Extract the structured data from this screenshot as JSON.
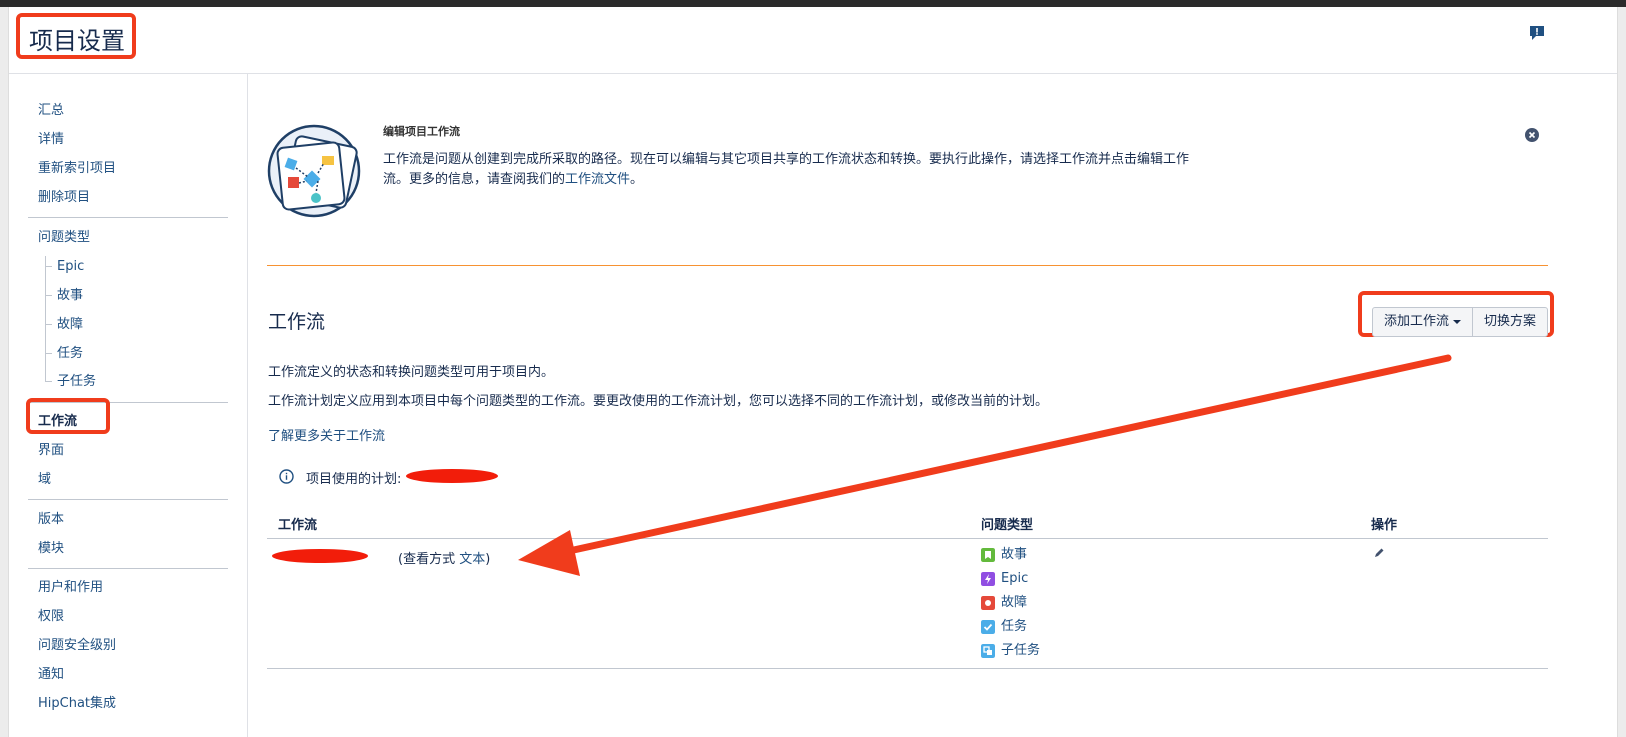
{
  "page": {
    "title": "项目设置"
  },
  "colors": {
    "annotation": "#f03c1c",
    "link": "#205081",
    "text": "#172b4d",
    "rule": "#f79232"
  },
  "sidebar": {
    "group1": [
      "汇总",
      "详情",
      "重新索引项目",
      "删除项目"
    ],
    "issue_types_label": "问题类型",
    "issue_types_sub": [
      "Epic",
      "故事",
      "故障",
      "任务",
      "子任务"
    ],
    "active": "工作流",
    "group2b": [
      "界面",
      "域"
    ],
    "group3": [
      "版本",
      "模块"
    ],
    "group4": [
      "用户和作用",
      "权限",
      "问题安全级别",
      "通知",
      "HipChat集成"
    ]
  },
  "info": {
    "title": "编辑项目工作流",
    "desc_part1": "工作流是问题从创建到完成所采取的路径。现在可以编辑与其它项目共享的工作流状态和转换。要执行此操作，请选择工作流并点击编辑工作流。更多的信息，请查阅我们的",
    "desc_link": "工作流文件",
    "desc_end": "。"
  },
  "workflow": {
    "section_title": "工作流",
    "add_button": "添加工作流",
    "switch_button": "切换方案",
    "para1": "工作流定义的状态和转换问题类型可用于项目内。",
    "para2": "工作流计划定义应用到本项目中每个问题类型的工作流。要更改使用的工作流计划，您可以选择不同的工作流计划，或修改当前的计划。",
    "learn_more": "了解更多关于工作流",
    "plan_label": "项目使用的计划:"
  },
  "table": {
    "columns": [
      "工作流",
      "问题类型",
      "操作"
    ],
    "view_prefix": "(查看方式 ",
    "view_link": "文本",
    "view_suffix": ")",
    "issue_types": [
      {
        "label": "故事",
        "icon": "story-icon",
        "color": "#63ba3c"
      },
      {
        "label": "Epic",
        "icon": "epic-icon",
        "color": "#904ee2"
      },
      {
        "label": "故障",
        "icon": "bug-icon",
        "color": "#e5493a"
      },
      {
        "label": "任务",
        "icon": "task-icon",
        "color": "#4bade8"
      },
      {
        "label": "子任务",
        "icon": "subtask-icon",
        "color": "#4bade8"
      }
    ]
  }
}
